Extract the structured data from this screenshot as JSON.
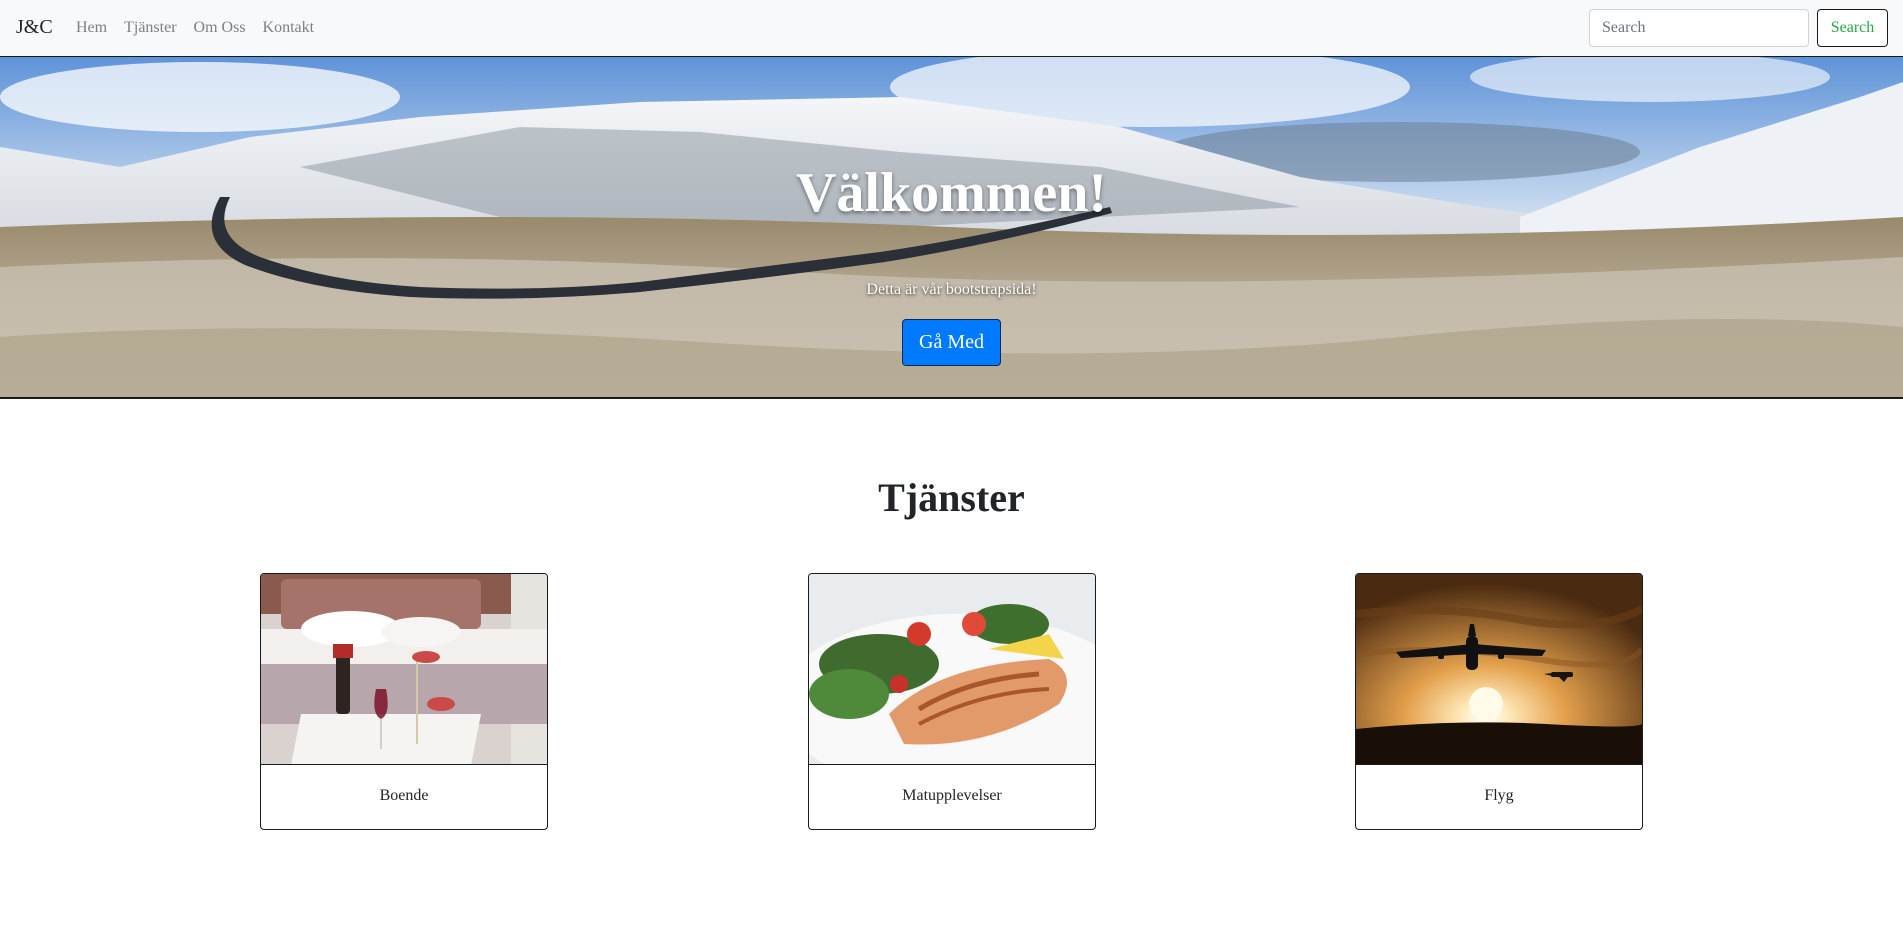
{
  "navbar": {
    "brand": "J&C",
    "links": [
      "Hem",
      "Tjänster",
      "Om Oss",
      "Kontakt"
    ],
    "search_placeholder": "Search",
    "search_button": "Search"
  },
  "hero": {
    "title": "Välkommen!",
    "subtitle": "Detta är vår bootstrapsida!",
    "button": "Gå Med"
  },
  "services": {
    "title": "Tjänster",
    "cards": [
      {
        "label": "Boende"
      },
      {
        "label": "Matupplevelser"
      },
      {
        "label": "Flyg"
      }
    ]
  },
  "colors": {
    "primary": "#007bff",
    "success": "#28a745",
    "navbar_bg": "#f8f9fa"
  }
}
